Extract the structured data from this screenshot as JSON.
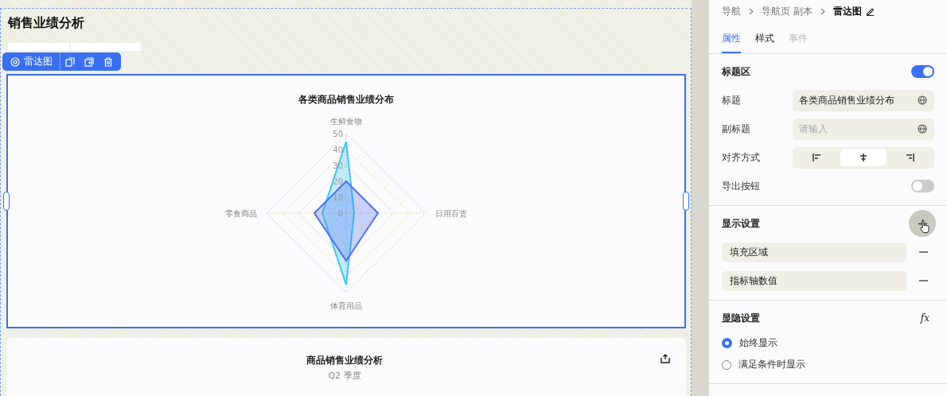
{
  "canvas": {
    "page_title": "销售业绩分析",
    "filters": [
      {
        "kind": "tab"
      },
      {
        "kind": "tab"
      }
    ],
    "toolbar": {
      "label": "雷达图"
    },
    "selected_chart": {
      "chart_data": {
        "type": "radar",
        "title": "各类商品销售业绩分布",
        "categories": [
          "生鲜食物",
          "日用百货",
          "体育用品",
          "零食商品"
        ],
        "yticks": [
          {
            "value": 0,
            "label": "0"
          },
          {
            "value": 10,
            "label": "10"
          },
          {
            "value": 20,
            "label": "20"
          },
          {
            "value": 30,
            "label": "30"
          },
          {
            "value": 40,
            "label": "40"
          },
          {
            "value": 50,
            "label": "50"
          }
        ],
        "ylim": [
          0,
          50
        ],
        "series": [
          {
            "color": "#3ec6f5",
            "values": [
              45,
              5,
              45,
              15
            ]
          },
          {
            "color": "#4f6ff0",
            "values": [
              20,
              20,
              30,
              20
            ]
          }
        ]
      }
    },
    "second_chart": {
      "title": "商品销售业绩分析",
      "subtitle": "Q2 季度"
    }
  },
  "panel": {
    "breadcrumb": [
      "导航",
      "导航页 副本",
      "雷达图"
    ],
    "tabs": [
      {
        "label": "属性",
        "selected": true,
        "disabled": false
      },
      {
        "label": "样式",
        "selected": false,
        "disabled": false
      },
      {
        "label": "事件",
        "selected": false,
        "disabled": true
      }
    ],
    "title_section": {
      "heading": "标题区",
      "on": true,
      "rows": [
        {
          "kind": "input",
          "label": "标题",
          "value": "各类商品销售业绩分布"
        },
        {
          "kind": "input",
          "label": "副标题",
          "placeholder": "请输入"
        },
        {
          "kind": "align",
          "label": "对齐方式",
          "options": [
            {
              "selected": false
            },
            {
              "selected": true
            },
            {
              "selected": false
            }
          ]
        },
        {
          "kind": "toggle",
          "label": "导出按钮",
          "on": false
        }
      ]
    },
    "display_section": {
      "heading": "显示设置",
      "items": [
        "填充区域",
        "指标轴数值"
      ]
    },
    "visibility_section": {
      "heading": "显隐设置",
      "formula": "fx",
      "options": [
        {
          "label": "始终显示",
          "selected": true
        },
        {
          "label": "满足条件时显示",
          "selected": false
        }
      ]
    }
  }
}
